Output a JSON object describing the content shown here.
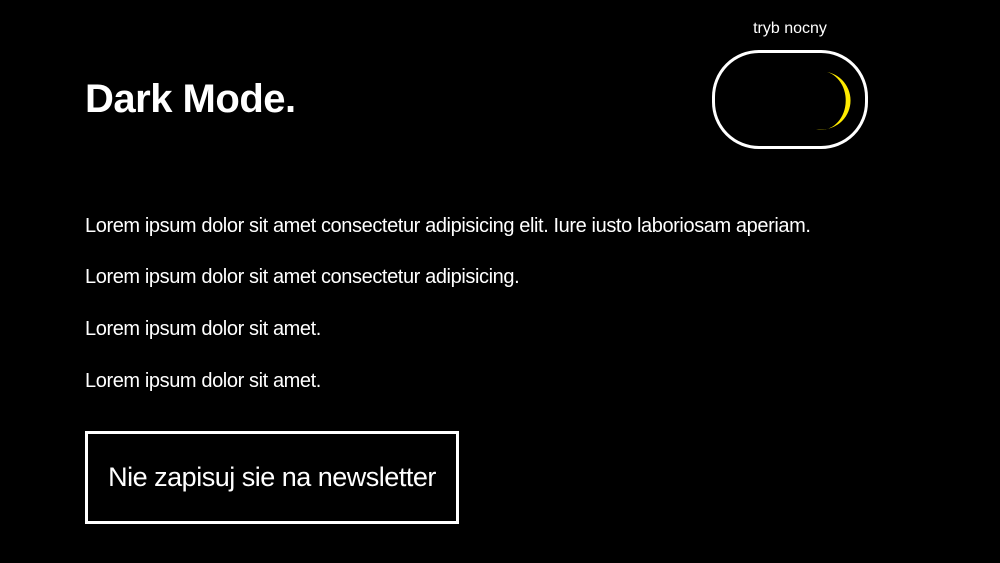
{
  "header": {
    "title": "Dark Mode."
  },
  "theme_toggle": {
    "label": "tryb nocny",
    "state": "on",
    "icon": "moon-icon",
    "icon_color": "#ffeb00"
  },
  "content": {
    "paragraphs": [
      "Lorem ipsum dolor sit amet consectetur adipisicing elit. Iure iusto laboriosam aperiam.",
      "Lorem ipsum dolor sit amet consectetur adipisicing.",
      "Lorem ipsum dolor sit amet.",
      "Lorem ipsum dolor sit amet."
    ]
  },
  "newsletter": {
    "button_label": "Nie zapisuj sie na newsletter"
  },
  "colors": {
    "background": "#000000",
    "foreground": "#ffffff",
    "accent": "#ffeb00"
  }
}
